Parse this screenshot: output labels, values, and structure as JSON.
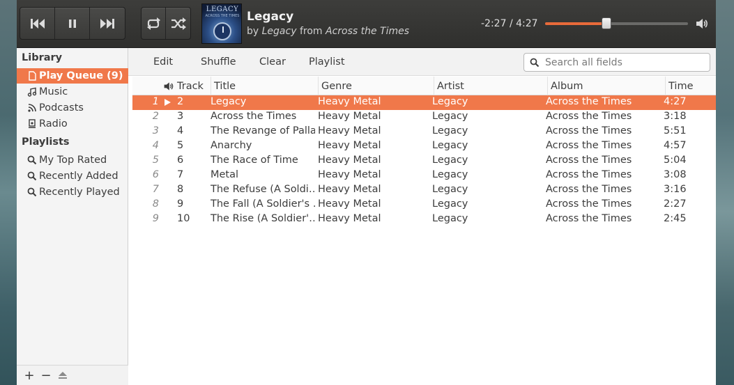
{
  "player": {
    "controls": {
      "previous": "previous-icon",
      "pause": "pause-icon",
      "next": "next-icon",
      "repeat": "repeat-icon",
      "shuffle": "shuffle-icon"
    },
    "now_playing": {
      "album_art_title": "LEGACY",
      "album_art_subtitle": "ACROSS THE TIMES",
      "title": "Legacy",
      "by_word": "by",
      "artist": "Legacy",
      "from_word": "from",
      "album": "Across the Times"
    },
    "time_readout": "-2:27 / 4:27",
    "progress_fraction": 0.43,
    "volume_icon": "volume-high-icon",
    "accent_color": "#e86a3a"
  },
  "sidebar": {
    "library_heading": "Library",
    "library_items": [
      {
        "label": "Play Queue (9)",
        "icon": "document-icon",
        "active": true
      },
      {
        "label": "Music",
        "icon": "music-note-icon",
        "active": false
      },
      {
        "label": "Podcasts",
        "icon": "rss-icon",
        "active": false
      },
      {
        "label": "Radio",
        "icon": "radio-icon",
        "active": false
      }
    ],
    "playlists_heading": "Playlists",
    "playlist_items": [
      {
        "label": "My Top Rated",
        "icon": "search-icon"
      },
      {
        "label": "Recently Added",
        "icon": "search-icon"
      },
      {
        "label": "Recently Played",
        "icon": "search-icon"
      }
    ],
    "footer": {
      "add": "+",
      "remove": "−",
      "eject": "eject-icon"
    }
  },
  "toolbar": {
    "items": [
      "Edit",
      "Shuffle",
      "Clear",
      "Playlist"
    ],
    "search_placeholder": "Search all fields"
  },
  "table": {
    "columns": {
      "track": "Track",
      "title": "Title",
      "genre": "Genre",
      "artist": "Artist",
      "album": "Album",
      "time": "Time"
    },
    "rows": [
      {
        "idx": "1",
        "track": "2",
        "title": "Legacy",
        "genre": "Heavy Metal",
        "artist": "Legacy",
        "album": "Across the Times",
        "time": "4:27",
        "playing": true
      },
      {
        "idx": "2",
        "track": "3",
        "title": "Across the Times",
        "genre": "Heavy Metal",
        "artist": "Legacy",
        "album": "Across the Times",
        "time": "3:18"
      },
      {
        "idx": "3",
        "track": "4",
        "title": "The Revange of Pallas",
        "genre": "Heavy Metal",
        "artist": "Legacy",
        "album": "Across the Times",
        "time": "5:51"
      },
      {
        "idx": "4",
        "track": "5",
        "title": "Anarchy",
        "genre": "Heavy Metal",
        "artist": "Legacy",
        "album": "Across the Times",
        "time": "4:57"
      },
      {
        "idx": "5",
        "track": "6",
        "title": "The Race of Time",
        "genre": "Heavy Metal",
        "artist": "Legacy",
        "album": "Across the Times",
        "time": "5:04"
      },
      {
        "idx": "6",
        "track": "7",
        "title": "Metal",
        "genre": "Heavy Metal",
        "artist": "Legacy",
        "album": "Across the Times",
        "time": "3:08"
      },
      {
        "idx": "7",
        "track": "8",
        "title": "The Refuse (A Soldi…",
        "genre": "Heavy Metal",
        "artist": "Legacy",
        "album": "Across the Times",
        "time": "3:16"
      },
      {
        "idx": "8",
        "track": "9",
        "title": "The Fall (A Soldier's …",
        "genre": "Heavy Metal",
        "artist": "Legacy",
        "album": "Across the Times",
        "time": "2:27"
      },
      {
        "idx": "9",
        "track": "10",
        "title": "The Rise (A Soldier'…",
        "genre": "Heavy Metal",
        "artist": "Legacy",
        "album": "Across the Times",
        "time": "2:45"
      }
    ]
  }
}
